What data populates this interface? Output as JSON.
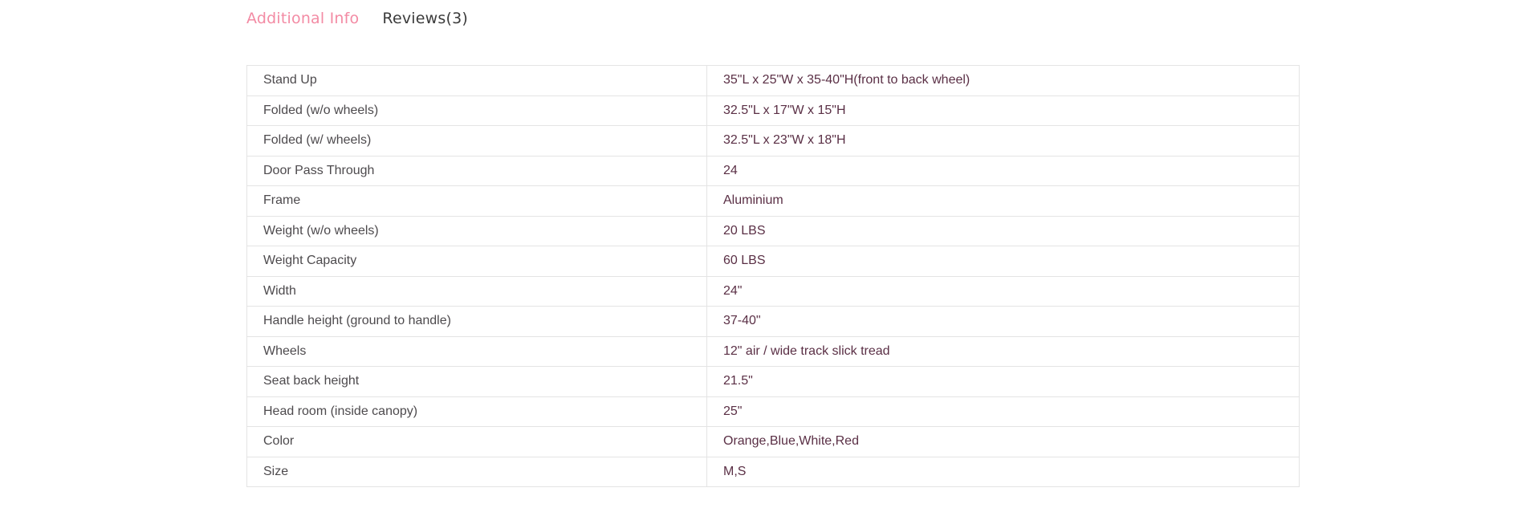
{
  "tabs": [
    {
      "label": "Additional Info",
      "active": true
    },
    {
      "label": "Reviews(3)",
      "active": false
    }
  ],
  "colors": {
    "active_tab": "#f38ba4",
    "inactive_tab": "#3b3b3b",
    "border": "#e4e4e4",
    "label_text": "#4d4a4d",
    "value_text": "#5a2f45"
  },
  "specs": [
    {
      "label": "Stand Up",
      "value": "35\"L x 25\"W x 35-40\"H(front to back wheel)"
    },
    {
      "label": "Folded (w/o wheels)",
      "value": "32.5\"L x 17\"W x 15\"H"
    },
    {
      "label": "Folded (w/ wheels)",
      "value": "32.5\"L x 23\"W x 18\"H"
    },
    {
      "label": "Door Pass Through",
      "value": "24"
    },
    {
      "label": "Frame",
      "value": "Aluminium"
    },
    {
      "label": "Weight (w/o wheels)",
      "value": "20 LBS"
    },
    {
      "label": "Weight Capacity",
      "value": "60 LBS"
    },
    {
      "label": "Width",
      "value": "24\""
    },
    {
      "label": "Handle height (ground to handle)",
      "value": "37-40\""
    },
    {
      "label": "Wheels",
      "value": "12\" air / wide track slick tread"
    },
    {
      "label": "Seat back height",
      "value": "21.5\""
    },
    {
      "label": "Head room (inside canopy)",
      "value": "25\""
    },
    {
      "label": "Color",
      "value": "Orange,Blue,White,Red"
    },
    {
      "label": "Size",
      "value": "M,S"
    }
  ]
}
